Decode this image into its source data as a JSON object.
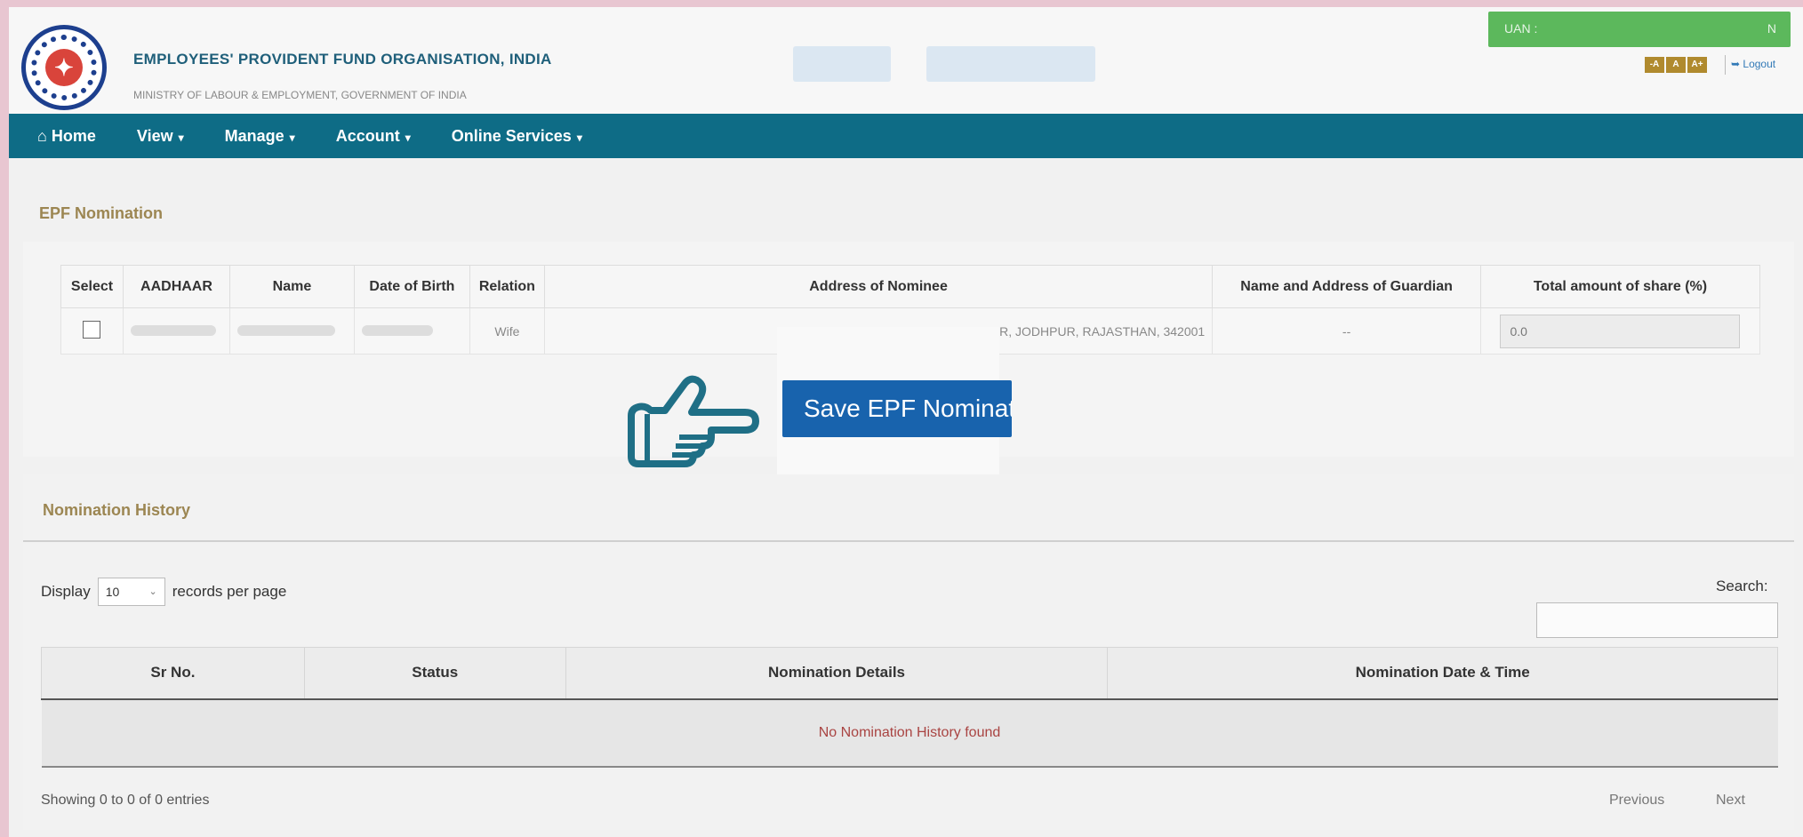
{
  "header": {
    "org_title": "EMPLOYEES' PROVIDENT FUND ORGANISATION, INDIA",
    "org_subtitle": "MINISTRY OF LABOUR & EMPLOYMENT, GOVERNMENT OF INDIA",
    "uan_label": "UAN :",
    "uan_value": "N",
    "font_buttons": [
      "-A",
      "A",
      "A+"
    ],
    "logout_label": "Logout",
    "colors": {
      "nav": "#0e6c86",
      "uan_bar": "#5cb85c",
      "section_title": "#9c8652"
    }
  },
  "nav": {
    "items": [
      {
        "label": "Home",
        "icon": "home-icon"
      },
      {
        "label": "View",
        "icon": "caret-down-icon"
      },
      {
        "label": "Manage",
        "icon": "caret-down-icon"
      },
      {
        "label": "Account",
        "icon": "caret-down-icon"
      },
      {
        "label": "Online Services",
        "icon": "caret-down-icon"
      }
    ]
  },
  "epf_nomination": {
    "title": "EPF Nomination",
    "columns": [
      "Select",
      "AADHAAR",
      "Name",
      "Date of Birth",
      "Relation",
      "Address of Nominee",
      "Name and Address of Guardian",
      "Total amount of share (%)"
    ],
    "row": {
      "relation": "Wife",
      "address_visible": "R, JODHPUR, RAJASTHAN, 342001",
      "guardian": "--",
      "share": "0.0"
    },
    "save_button": "Save EPF Nomination"
  },
  "nomination_history": {
    "title": "Nomination History",
    "display_label": "Display",
    "page_size": "10",
    "records_label": "records per page",
    "search_label": "Search:",
    "columns": [
      "Sr No.",
      "Status",
      "Nomination Details",
      "Nomination Date & Time"
    ],
    "empty_message": "No Nomination History found",
    "showing": "Showing 0 to 0 of 0 entries",
    "previous": "Previous",
    "next": "Next"
  }
}
